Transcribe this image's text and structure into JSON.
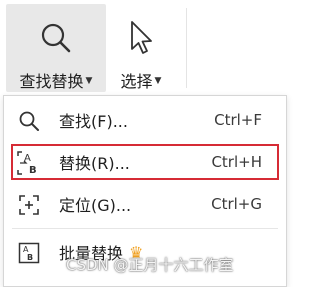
{
  "ribbon": {
    "find_replace": {
      "label": "查找替换",
      "icon": "magnifier-icon"
    },
    "select": {
      "label": "选择",
      "icon": "cursor-arrow-icon"
    }
  },
  "menu": {
    "items": [
      {
        "label": "查找(F)...",
        "shortcut": "Ctrl+F",
        "icon": "search-icon"
      },
      {
        "label": "替换(R)...",
        "shortcut": "Ctrl+H",
        "icon": "replace-ab-icon",
        "highlighted": true
      },
      {
        "label": "定位(G)...",
        "shortcut": "Ctrl+G",
        "icon": "locate-icon"
      },
      {
        "label": "批量替换",
        "shortcut": "",
        "icon": "batch-replace-icon",
        "badge_icon": "crown-icon"
      }
    ]
  },
  "watermark": "CSDN @正月十六工作室",
  "colors": {
    "highlight_border": "#d62b35",
    "active_ribbon_bg": "#e8e8e8"
  }
}
